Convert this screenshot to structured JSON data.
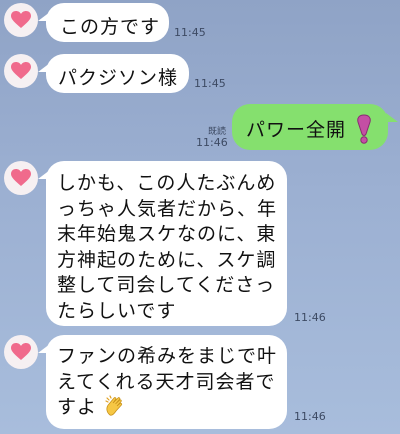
{
  "messages": [
    {
      "text": "この方です",
      "time": "11:45"
    },
    {
      "text": "パクジソン様",
      "time": "11:45"
    },
    {
      "text": "パワー全開",
      "emoji": "exclamation-icon",
      "time": "11:46",
      "read": "既読"
    },
    {
      "lines": [
        "しかも、この人たぶんめ",
        "っちゃ人気者だから、年",
        "末年始鬼スケなのに、東",
        "方神起のために、スケ調",
        "整して司会してくださっ",
        "たらしいです"
      ],
      "time": "11:46"
    },
    {
      "lines": [
        "ファンの希みをまじで叶",
        "えてくれる天才司会者で",
        "すよ"
      ],
      "emoji": "clapping-hands-icon",
      "time": "11:46"
    }
  ],
  "colors": {
    "incoming_bubble": "#ffffff",
    "outgoing_bubble": "#85e06e",
    "avatar_heart": "#f06a8c"
  }
}
